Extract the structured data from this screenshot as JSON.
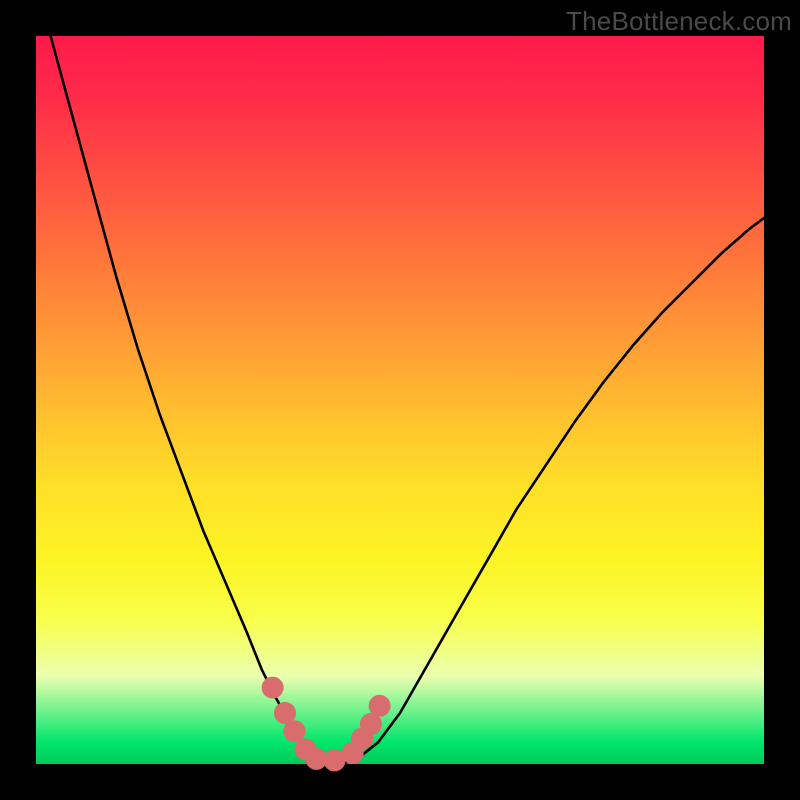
{
  "watermark": {
    "text": "TheBottleneck.com"
  },
  "chart_data": {
    "type": "line",
    "title": "",
    "xlabel": "",
    "ylabel": "",
    "xlim": [
      0,
      100
    ],
    "ylim": [
      0,
      100
    ],
    "grid": false,
    "legend": false,
    "background": "vertical-gradient-red-to-green",
    "series": [
      {
        "name": "bottleneck-curve",
        "color": "#000000",
        "x": [
          2,
          5,
          8,
          11,
          14,
          17,
          20,
          23,
          26,
          29,
          31,
          33,
          35,
          36.5,
          38,
          40,
          42,
          44.5,
          47,
          50,
          54,
          58,
          62,
          66,
          70,
          74,
          78,
          82,
          86,
          90,
          94,
          98,
          100
        ],
        "y": [
          100,
          89,
          78,
          67,
          57,
          48,
          40,
          32,
          25,
          18,
          13,
          9,
          5.5,
          3,
          1,
          0,
          0,
          1,
          3,
          7,
          14,
          21,
          28,
          35,
          41,
          47,
          52.5,
          57.5,
          62,
          66,
          70,
          73.5,
          75
        ]
      },
      {
        "name": "highlight-dots",
        "color": "#d96c6c",
        "type": "scatter",
        "x": [
          32.5,
          34.2,
          35.5,
          37.0,
          38.5,
          41.0,
          43.5,
          44.8,
          46.0,
          47.2
        ],
        "y": [
          10.5,
          7.0,
          4.5,
          2.0,
          0.7,
          0.5,
          1.5,
          3.5,
          5.5,
          8.0
        ]
      }
    ]
  }
}
